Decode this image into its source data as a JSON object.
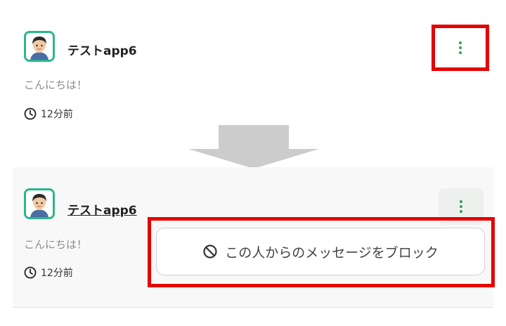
{
  "post_before": {
    "username": "テストapp6",
    "message": "こんにちは！",
    "time": "12分前"
  },
  "post_after": {
    "username": "テストapp6",
    "message": "こんにちは！",
    "time": "12分前"
  },
  "menu": {
    "block_label": "この人からのメッセージをブロック"
  },
  "colors": {
    "highlight": "#e60000",
    "accent_green": "#2aa55a",
    "avatar_border": "#2bb68a",
    "arrow": "#cccccc"
  },
  "icons": [
    "avatar-icon",
    "clock-icon",
    "more-vertical-icon",
    "block-icon",
    "down-arrow-icon"
  ]
}
